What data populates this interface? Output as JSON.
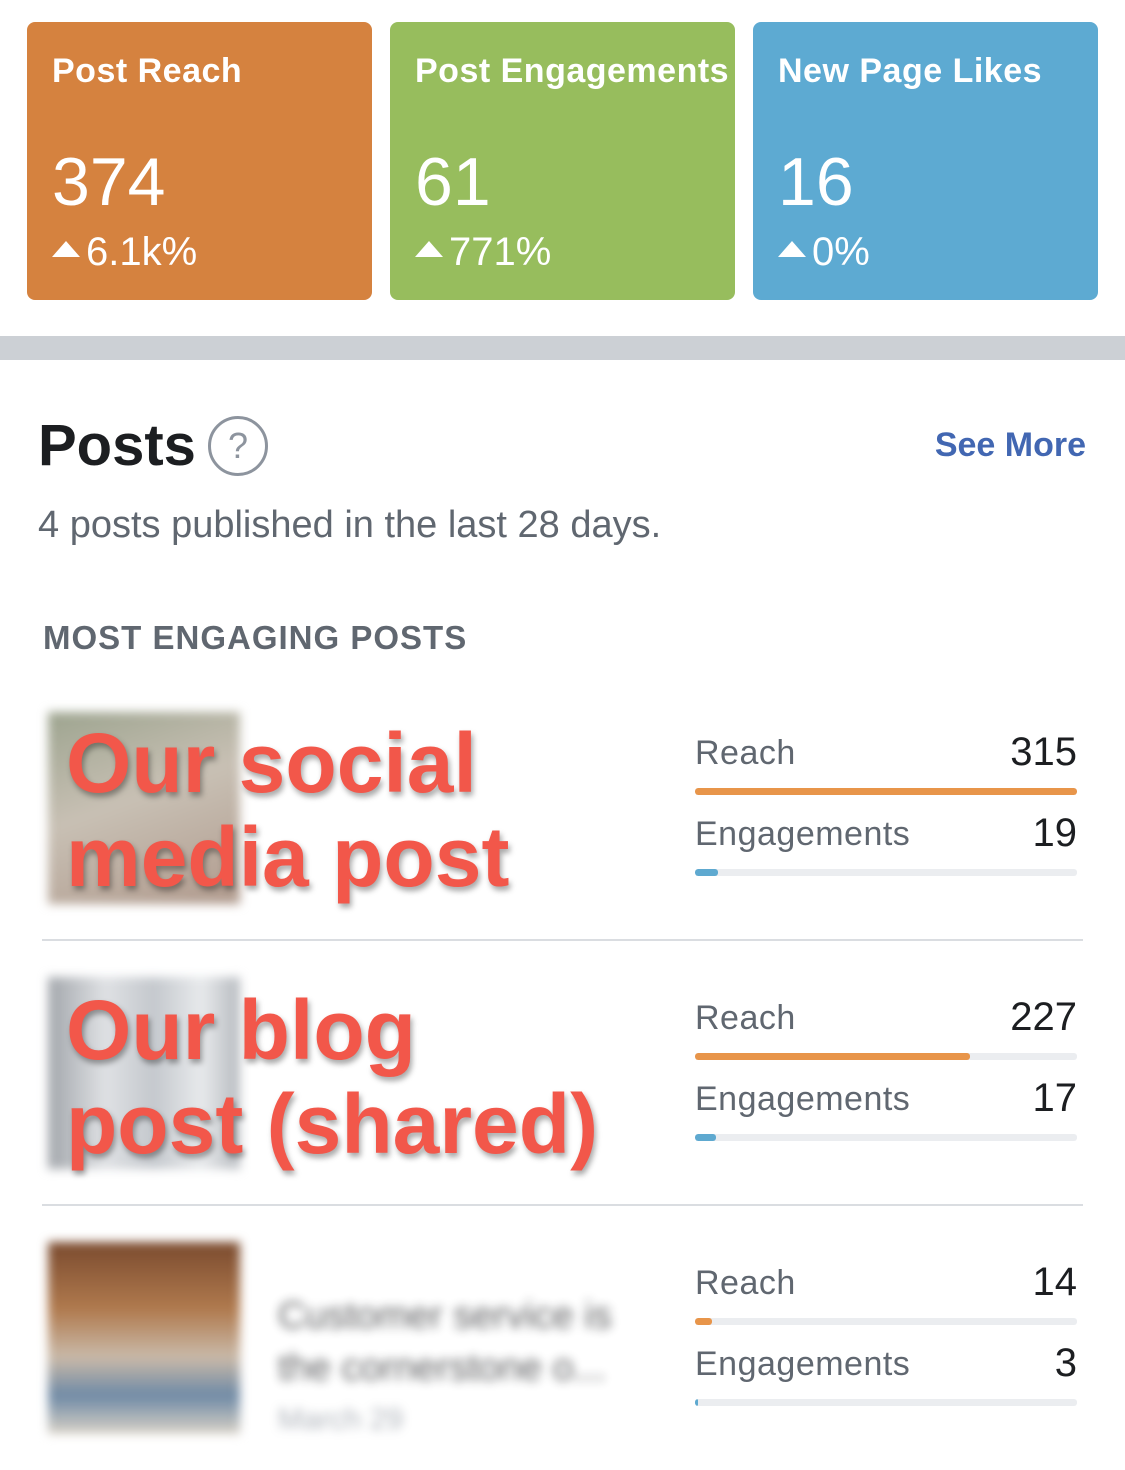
{
  "colors": {
    "reach_card": "#d5823f",
    "engagements_card": "#97bd5d",
    "likes_card": "#5daad2",
    "link": "#4267b2",
    "overlay_text": "#f2574a",
    "reach_bar": "#e8954a",
    "engagement_bar": "#5ea9d0"
  },
  "metrics": [
    {
      "title": "Post Reach",
      "value": "374",
      "change": "6.1k%",
      "icon": "arrow-up-icon"
    },
    {
      "title": "Post Engagements",
      "value": "61",
      "change": "771%",
      "icon": "arrow-up-icon"
    },
    {
      "title": "New Page Likes",
      "value": "16",
      "change": "0%",
      "icon": "arrow-up-icon"
    }
  ],
  "posts_section": {
    "title": "Posts",
    "help_icon": "question-circle-icon",
    "see_more": "See More",
    "subtitle": "4 posts published in the last 28 days.",
    "section_label": "MOST ENGAGING POSTS"
  },
  "posts": [
    {
      "overlay_label": "Our social\nmedia post",
      "blurred_text": "",
      "reach_label": "Reach",
      "reach": 315,
      "reach_fraction": 1.0,
      "engagements_label": "Engagements",
      "engagements": 19,
      "engagements_fraction": 0.06
    },
    {
      "overlay_label": "Our blog\npost (shared)",
      "blurred_text": "",
      "reach_label": "Reach",
      "reach": 227,
      "reach_fraction": 0.72,
      "engagements_label": "Engagements",
      "engagements": 17,
      "engagements_fraction": 0.054
    },
    {
      "overlay_label": "",
      "blurred_line_1": "Customer service is",
      "blurred_line_2": "the cornerstone o...",
      "blurred_date": "March 29",
      "reach_label": "Reach",
      "reach": 14,
      "reach_fraction": 0.044,
      "engagements_label": "Engagements",
      "engagements": 3,
      "engagements_fraction": 0.009
    }
  ]
}
